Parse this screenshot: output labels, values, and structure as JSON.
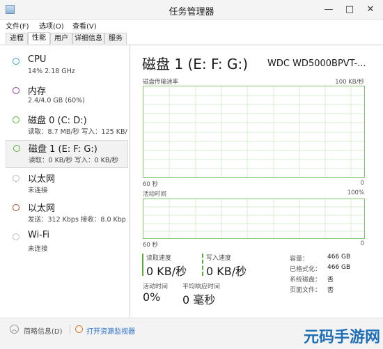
{
  "window": {
    "title": "任务管理器",
    "minimize_glyph": "—",
    "maximize_glyph": "□",
    "close_glyph": "✕"
  },
  "menu": [
    "文件(F)",
    "选项(O)",
    "查看(V)"
  ],
  "tabs": [
    "进程",
    "性能",
    "用户",
    "详细信息",
    "服务"
  ],
  "active_tab": "性能",
  "resources": [
    {
      "name": "CPU",
      "sub": "14%  2.18 GHz",
      "color": "#3aa0d8"
    },
    {
      "name": "内存",
      "sub": "2.4/4.0 GB (60%)",
      "color": "#9b3fa8"
    },
    {
      "name": "磁盘 0 (C: D:)",
      "sub": "读取：8.7 MB/秒  写入：125 KB/",
      "color": "#5aae3a"
    },
    {
      "name": "磁盘 1 (E: F: G:)",
      "sub": "读取：0 KB/秒  写入：0 KB/秒",
      "color": "#5aae3a"
    },
    {
      "name": "以太网",
      "sub": "未连接",
      "color": "#bfbfbf"
    },
    {
      "name": "以太网",
      "sub": "发送：312 Kbps  接收：8.0 Kbp",
      "color": "#a0522d"
    },
    {
      "name": "Wi-Fi",
      "sub": "未连接",
      "color": "#bfbfbf"
    }
  ],
  "selected_resource": "磁盘 1 (E: F: G:)",
  "detail": {
    "title": "磁盘 1 (E: F: G:)",
    "model": "WDC WD5000BPVT-...",
    "graph1": {
      "label": "磁盘传输速率",
      "max": "100 KB/秒",
      "time_label": "60 秒",
      "min": "0"
    },
    "graph2": {
      "label": "活动时间",
      "max": "100%",
      "time_label": "60 秒",
      "min": "0"
    },
    "stats": {
      "read_label": "读取速度",
      "read_value": "0 KB/秒",
      "write_label": "写入速度",
      "write_value": "0 KB/秒",
      "active_label": "活动时间",
      "active_value": "0%",
      "response_label": "平均响应时间",
      "response_value": "0 毫秒"
    },
    "info": [
      {
        "label": "容量：",
        "value": "466 GB"
      },
      {
        "label": "已格式化：",
        "value": "466 GB"
      },
      {
        "label": "系统磁盘：",
        "value": "否"
      },
      {
        "label": "页面文件：",
        "value": "否"
      }
    ]
  },
  "bottom": {
    "summary_label": "简略信息(D)",
    "resmon_label": "打开资源监视器"
  },
  "watermark": "元码手游网",
  "colors": {
    "graph_border": "#7cc46a",
    "graph_grid": "#d9eed3",
    "accent_link": "#2a6ec9"
  }
}
